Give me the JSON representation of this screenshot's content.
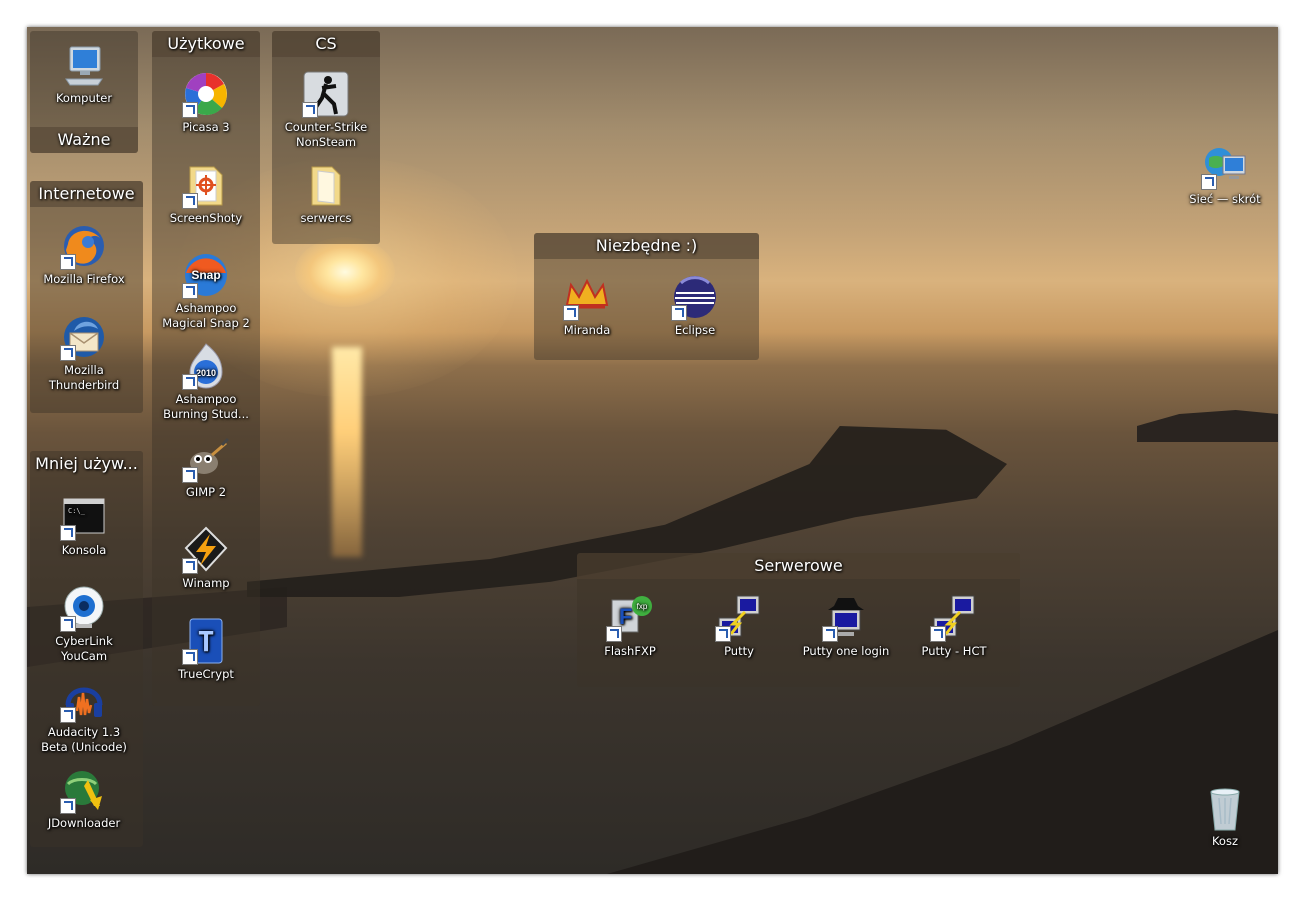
{
  "groups": {
    "wazne": {
      "title": "Ważne"
    },
    "internetowe": {
      "title": "Internetowe"
    },
    "mniej": {
      "title": "Mniej używ..."
    },
    "uzytkowe": {
      "title": "Użytkowe"
    },
    "cs": {
      "title": "CS"
    },
    "niezbedne": {
      "title": "Niezbędne :)"
    },
    "serwerowe": {
      "title": "Serwerowe"
    }
  },
  "icons": {
    "komputer": "Komputer",
    "firefox": "Mozilla Firefox",
    "thunderbird": "Mozilla Thunderbird",
    "konsola": "Konsola",
    "youcam": "CyberLink YouCam",
    "audacity": "Audacity 1.3 Beta (Unicode)",
    "jdownloader": "JDownloader",
    "picasa": "Picasa 3",
    "screenshoty": "ScreenShoty",
    "snap": "Ashampoo Magical Snap 2",
    "burning": "Ashampoo Burning Stud...",
    "gimp": "GIMP 2",
    "winamp": "Winamp",
    "truecrypt": "TrueCrypt",
    "counterstrike": "Counter-Strike NonSteam",
    "serwercs": "serwercs",
    "miranda": "Miranda",
    "eclipse": "Eclipse",
    "flashfxp": "FlashFXP",
    "putty": "Putty",
    "putty_login": "Putty one login",
    "putty_hct": "Putty - HCT",
    "siec": "Sieć — skrót",
    "kosz": "Kosz"
  },
  "colors": {
    "group_bg": "#3c3228",
    "title_bg": "#504132",
    "label": "#ffffff"
  }
}
